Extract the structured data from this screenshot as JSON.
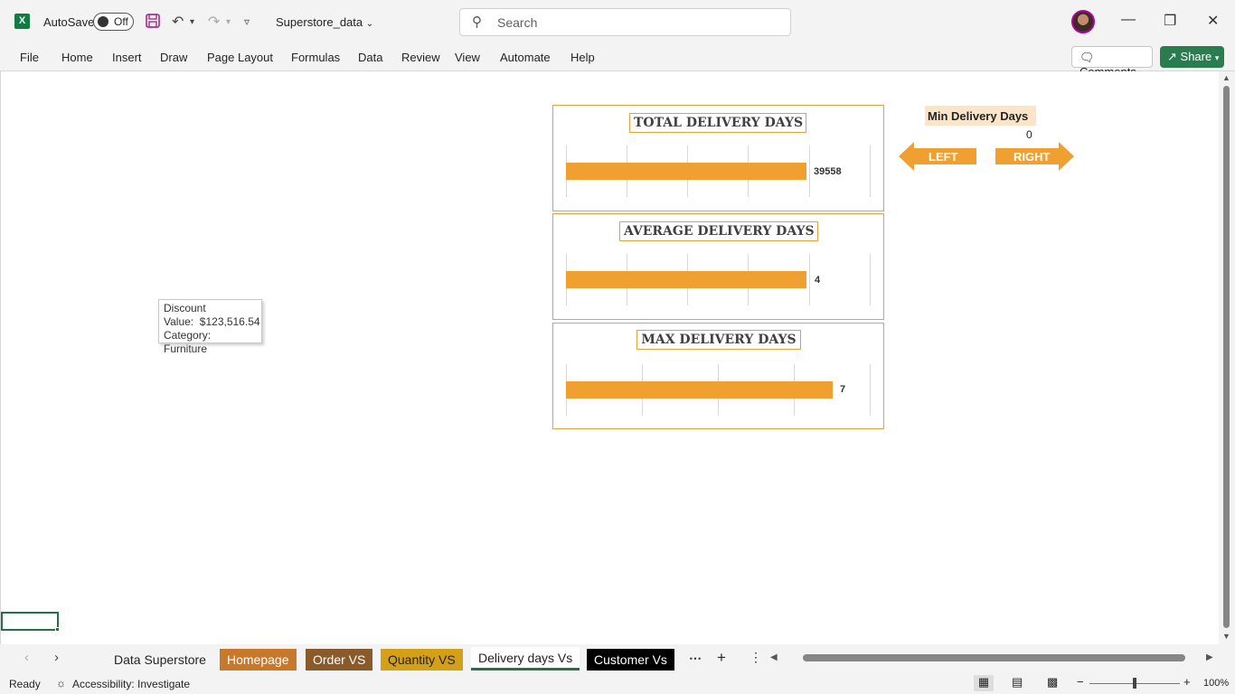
{
  "titlebar": {
    "app_icon": "excel-icon",
    "autosave_label": "AutoSave",
    "autosave_state": "Off",
    "filename": "Superstore_data",
    "search_placeholder": "Search"
  },
  "ribbon": {
    "menu": [
      "File",
      "Home",
      "Insert",
      "Draw",
      "Page Layout",
      "Formulas",
      "Data",
      "Review",
      "View",
      "Automate",
      "Help"
    ],
    "comments_label": "Comments",
    "share_label": "Share"
  },
  "dashboard": {
    "accent_color": "#f0a030",
    "charts": [
      {
        "title": "TOTAL DELIVERY DAYS",
        "value_label": "39558"
      },
      {
        "title": "AVERAGE DELIVERY DAYS",
        "value_label": "4"
      },
      {
        "title": "MAX DELIVERY DAYS",
        "value_label": "7"
      }
    ],
    "min_label": "Min Delivery Days",
    "min_value": "0",
    "left_label": "LEFT",
    "right_label": "RIGHT"
  },
  "tooltip": {
    "line1": "Discount",
    "line2": "Value:  $123,516.54",
    "line3": "Category: Furniture"
  },
  "sheet_tabs": [
    {
      "label": "Data Superstore",
      "bg": "",
      "color": "#242424"
    },
    {
      "label": "Homepage",
      "bg": "#c8782a",
      "color": "#ffffff"
    },
    {
      "label": "Order VS",
      "bg": "#8b5a2b",
      "color": "#ffffff"
    },
    {
      "label": "Quantity VS",
      "bg": "#d4a017",
      "color": "#242424"
    },
    {
      "label": "Delivery days Vs",
      "bg": "",
      "color": "#242424",
      "active": true
    },
    {
      "label": "Customer Vs",
      "bg": "#000000",
      "color": "#ffffff"
    }
  ],
  "statusbar": {
    "ready": "Ready",
    "accessibility": "Accessibility: Investigate",
    "zoom": "100%"
  }
}
